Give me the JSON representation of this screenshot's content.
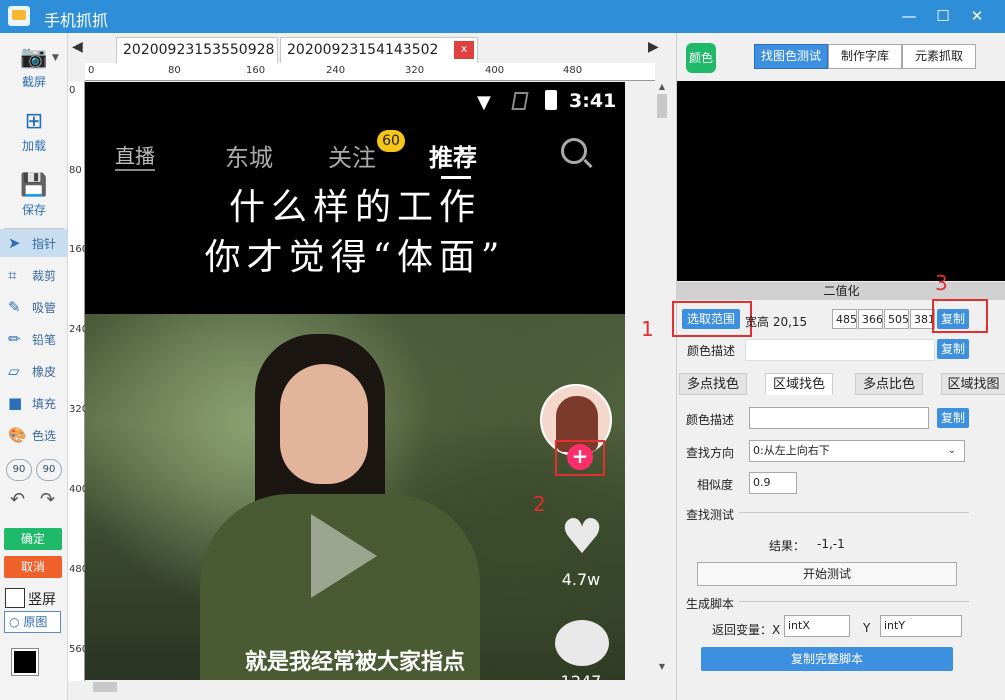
{
  "window": {
    "title": "手机抓抓",
    "minimize": "—",
    "maximize": "☐",
    "close": "✕"
  },
  "left_toolbar": {
    "big": [
      {
        "label": "截屏",
        "icon": "camera-icon",
        "glyph": "📷"
      },
      {
        "label": "加载",
        "icon": "load-icon",
        "glyph": "⊞"
      },
      {
        "label": "保存",
        "icon": "save-icon",
        "glyph": "💾"
      }
    ],
    "tools": [
      {
        "label": "指针",
        "icon": "pointer-icon",
        "glyph": "➤"
      },
      {
        "label": "裁剪",
        "icon": "crop-icon",
        "glyph": "⌗"
      },
      {
        "label": "吸管",
        "icon": "eyedropper-icon",
        "glyph": "✎"
      },
      {
        "label": "铅笔",
        "icon": "pencil-icon",
        "glyph": "✏"
      },
      {
        "label": "橡皮",
        "icon": "eraser-icon",
        "glyph": "▱"
      },
      {
        "label": "填充",
        "icon": "fill-icon",
        "glyph": "■"
      },
      {
        "label": "色选",
        "icon": "palette-icon",
        "glyph": "🎨"
      }
    ],
    "rotate_ccw": "90",
    "rotate_cw": "90",
    "undo": "↶",
    "redo": "↷",
    "confirm": "确定",
    "cancel": "取消",
    "portrait": "竖屏",
    "original": "原图"
  },
  "tabs": [
    {
      "label": "20200923153550928"
    },
    {
      "label": "20200923154143502",
      "close": "x"
    }
  ],
  "ruler": {
    "h_ticks": [
      "0",
      "80",
      "160",
      "240",
      "320",
      "400",
      "480"
    ],
    "v_ticks": [
      "0",
      "80",
      "160",
      "240",
      "320",
      "400",
      "480",
      "560"
    ]
  },
  "phone": {
    "time": "3:41",
    "nav": {
      "live": "直播",
      "city": "东城",
      "follow": "关注",
      "follow_badge": "60",
      "recommend": "推荐"
    },
    "headline_1": "什么样的工作",
    "headline_2": "你才觉得“体面”",
    "likes": "4.7w",
    "comments": "1247",
    "subtitle": "就是我经常被大家指点"
  },
  "annotations": {
    "n1": "1",
    "n2": "2",
    "n3": "3"
  },
  "right_panel": {
    "color_button": "颜色",
    "segments": [
      "找图色测试",
      "制作字库",
      "元素抓取"
    ],
    "section_binary": "二值化",
    "select_range": "选取范围",
    "width_height": "宽高 20,15",
    "coords": [
      "485",
      "366",
      "505",
      "381"
    ],
    "copy": "复制",
    "color_desc_label": "颜色描述",
    "subtabs": [
      "多点找色",
      "区域找色",
      "多点比色",
      "区域找图"
    ],
    "area": {
      "color_desc_label": "颜色描述",
      "color_desc_value": "",
      "direction_label": "查找方向",
      "direction_value": "0:从左上向右下",
      "similarity_label": "相似度",
      "similarity_value": "0.9",
      "test_section": "查找测试",
      "result_label": "结果：",
      "result_value": "-1,-1",
      "start_test": "开始测试",
      "gen_section": "生成脚本",
      "return_var_label": "返回变量：X",
      "var_x": "intX",
      "y_label": "Y",
      "var_y": "intY",
      "copy_full": "复制完整脚本"
    }
  }
}
